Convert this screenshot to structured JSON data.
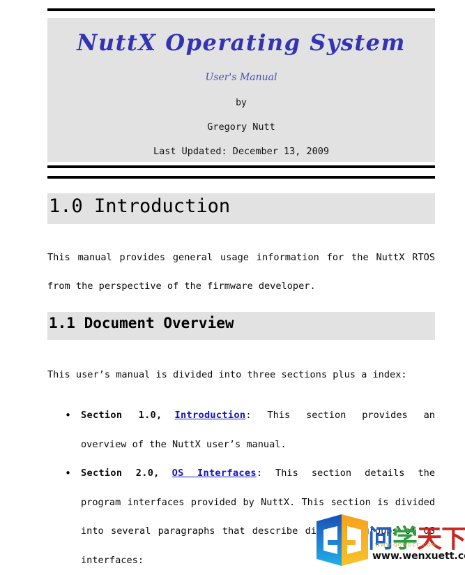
{
  "document": {
    "title": "NuttX Operating System",
    "subtitle": "User's Manual",
    "by_label": "by",
    "author": "Gregory Nutt",
    "last_updated": "Last Updated: December 13, 2009"
  },
  "sections": {
    "h1": "1.0 Introduction",
    "h1_paragraph": "This manual provides general usage information for the NuttX RTOS from the perspective of the firmware developer.",
    "h2": "1.1 Document Overview",
    "h2_paragraph": "This user’s manual is divided into three sections plus a index:"
  },
  "bullets": [
    {
      "label": "Section 1.0,",
      "link": "Introduction",
      "text": ": This section provides an overview of the NuttX user’s manual."
    },
    {
      "label": "Section 2.0,",
      "link": "OS Interfaces",
      "text": ": This section details the program interfaces provided by NuttX. This section is divided into several paragraphs that describe different groups of OS interfaces:"
    }
  ],
  "watermark": {
    "brand_chars": [
      "问",
      "学",
      "天",
      "下"
    ],
    "url": "www.wenxuett.com",
    "sub_url": "WWW.QQWDCC.COM"
  },
  "colors": {
    "title": "#3333b5",
    "subtitle": "#4a4ab8",
    "link": "#1414c8",
    "band_background": "#e2e2e2",
    "rule": "#000000",
    "page_background": "#ffffff"
  }
}
